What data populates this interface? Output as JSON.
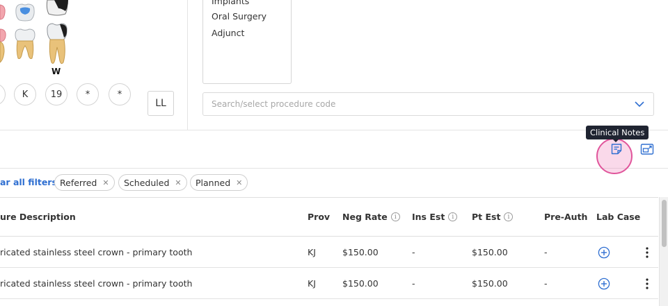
{
  "tooth_chart": {
    "tooth_label": "W",
    "quadrant_buttons": [
      "K",
      "19",
      "*",
      "*"
    ],
    "ll_label": "LL"
  },
  "procedures": {
    "categories": [
      "Implants",
      "Oral Surgery",
      "Adjunct"
    ],
    "search_placeholder": "Search/select procedure code"
  },
  "toolbar": {
    "tooltip": "Clinical Notes"
  },
  "filters": {
    "clear_label": "ar all filters",
    "chips": [
      "Referred",
      "Scheduled",
      "Planned"
    ]
  },
  "table": {
    "headers": {
      "description": "ure Description",
      "prov": "Prov",
      "neg_rate": "Neg Rate",
      "ins_est": "Ins Est",
      "pt_est": "Pt Est",
      "pre_auth": "Pre-Auth",
      "lab_case": "Lab Case"
    },
    "rows": [
      {
        "description": "ricated stainless steel crown - primary tooth",
        "prov": "KJ",
        "neg_rate": "$150.00",
        "ins_est": "-",
        "pt_est": "$150.00",
        "pre_auth": "-"
      },
      {
        "description": "ricated stainless steel crown - primary tooth",
        "prov": "KJ",
        "neg_rate": "$150.00",
        "ins_est": "-",
        "pt_est": "$150.00",
        "pre_auth": "-"
      }
    ]
  },
  "colors": {
    "accent": "#2f6fd1",
    "highlight": "#e0559b",
    "tooltip_bg": "#1f2431"
  }
}
